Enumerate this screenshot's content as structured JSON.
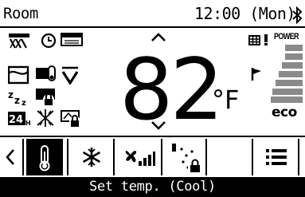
{
  "header": {
    "room_label": "Room",
    "time": "12:00",
    "day": "(Mon)",
    "bluetooth_icon": "bluetooth-icon"
  },
  "left_icons": [
    "fan-louver-icon",
    "timer-clock-icon",
    "filter-icon",
    "weekly-timer-icon",
    "thermostat-card-icon",
    "vane-v-icon",
    "sleep-zzz-icon",
    "lock-card-icon",
    "24h-icon",
    "defrost-icon",
    "lock-card-icon"
  ],
  "temperature": {
    "value": "82",
    "unit": "°F"
  },
  "energy": {
    "power_label": "POWER",
    "eco_label": "eco",
    "bar_color": "#8a8a8a"
  },
  "tabs": [
    {
      "name": "back",
      "icon": "chevron-left-icon"
    },
    {
      "name": "set-temp",
      "icon": "thermometer-icon",
      "selected": true
    },
    {
      "name": "mode",
      "icon": "snowflake-icon"
    },
    {
      "name": "fan-speed",
      "icon": "fan-speed-icon"
    },
    {
      "name": "air-direction",
      "icon": "air-direction-lock-icon"
    },
    {
      "name": "blank",
      "icon": ""
    },
    {
      "name": "menu",
      "icon": "menu-icon"
    }
  ],
  "status_bar": {
    "text": "Set temp. (Cool)"
  }
}
